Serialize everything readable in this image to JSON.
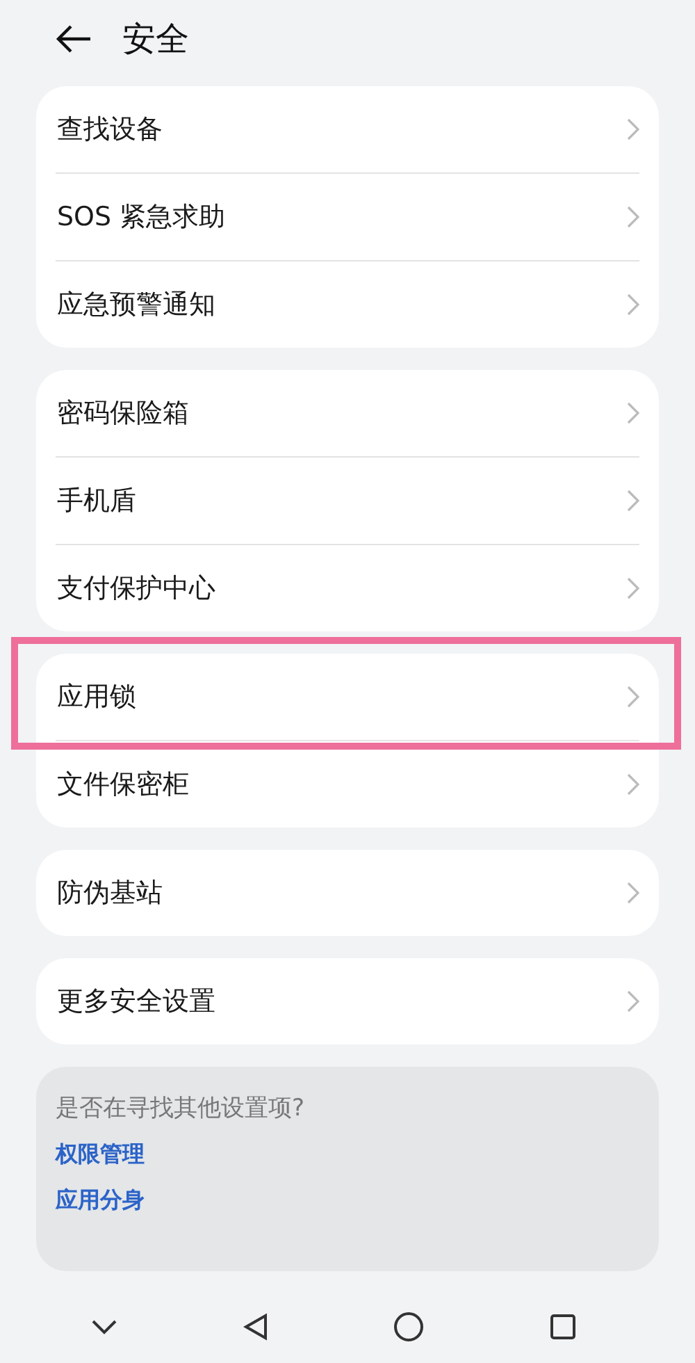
{
  "header": {
    "title": "安全"
  },
  "groups": [
    {
      "items": [
        {
          "label": "查找设备",
          "highlighted": false
        },
        {
          "label": "SOS 紧急求助",
          "highlighted": false
        },
        {
          "label": "应急预警通知",
          "highlighted": false
        }
      ]
    },
    {
      "items": [
        {
          "label": "密码保险箱",
          "highlighted": false
        },
        {
          "label": "手机盾",
          "highlighted": false
        },
        {
          "label": "支付保护中心",
          "highlighted": false
        }
      ]
    },
    {
      "items": [
        {
          "label": "应用锁",
          "highlighted": true
        },
        {
          "label": "文件保密柜",
          "highlighted": false
        }
      ]
    },
    {
      "items": [
        {
          "label": "防伪基站",
          "highlighted": false
        }
      ]
    },
    {
      "items": [
        {
          "label": "更多安全设置",
          "highlighted": false
        }
      ]
    }
  ],
  "suggestions": {
    "title": "是否在寻找其他设置项?",
    "links": [
      "权限管理",
      "应用分身"
    ]
  }
}
